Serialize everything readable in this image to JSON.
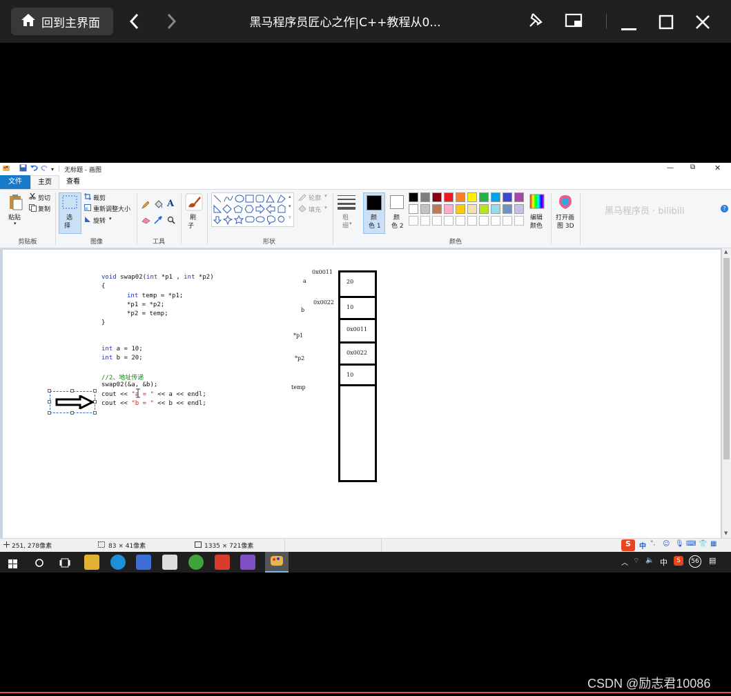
{
  "player": {
    "home_label": "回到主界面",
    "title": "黑马程序员匠心之作|C++教程从0..."
  },
  "paint": {
    "quick_access": {
      "title": "无标题 - 画图"
    },
    "tabs": [
      {
        "label": "文件"
      },
      {
        "label": "主页"
      },
      {
        "label": "查看"
      }
    ],
    "watermark": "黑马程序员 · bilibili",
    "ribbon": {
      "clipboard": {
        "paste": "粘贴",
        "cut": "剪切",
        "copy": "复制",
        "label": "剪贴板"
      },
      "image": {
        "select": "选",
        "select2": "择",
        "crop": "裁剪",
        "resize": "重新调整大小",
        "rotate": "旋转",
        "label": "图像"
      },
      "tools": {
        "label": "工具"
      },
      "brush": {
        "label1": "刷",
        "label2": "子"
      },
      "shapes": {
        "outline": "轮廓",
        "fill": "填充",
        "label": "形状"
      },
      "size": {
        "label1": "粗",
        "label2": "细"
      },
      "color1": {
        "label1": "颜",
        "label2": "色 1"
      },
      "color2": {
        "label1": "颜",
        "label2": "色 2"
      },
      "edit_colors": {
        "label1": "编辑",
        "label2": "颜色"
      },
      "paint3d": {
        "label1": "打开画",
        "label2": "图 3D"
      },
      "colors_label": "颜色"
    },
    "palette_row1": [
      "#000000",
      "#7f7f7f",
      "#880015",
      "#ed1c24",
      "#ff7f27",
      "#fff200",
      "#22b14c",
      "#00a2e8",
      "#3f48cc",
      "#a349a4"
    ],
    "palette_row2": [
      "#ffffff",
      "#c3c3c3",
      "#b97a57",
      "#ffaec9",
      "#ffc90e",
      "#efe4b0",
      "#b5e61d",
      "#99d9ea",
      "#7092be",
      "#c8bfe7"
    ],
    "code": {
      "l1_void": "void",
      "l1_sig": " swap02(",
      "l1_int1": "int",
      "l1_p1": " *p1 , ",
      "l1_int2": "int",
      "l1_p2": " *p2)",
      "l2": "{",
      "l3_int": "int",
      "l3_rest": " temp = *p1;",
      "l4": "*p1 = *p2;",
      "l5": "*p2 = temp;",
      "l6": "}",
      "l7_int": "int",
      "l7_rest": " a = 10;",
      "l8_int": "int",
      "l8_rest": " b = 20;",
      "l9": "//2、地址传递",
      "l10": "swap02(&a, &b);",
      "l11_a": "cout << ",
      "l11_s": "\"a = \"",
      "l11_b": " << a << endl;",
      "l12_a": "cout << ",
      "l12_s": "\"b = \"",
      "l12_b": " << b << endl;"
    },
    "memory": {
      "addr1": "0x0011",
      "addr2": "0x0022",
      "label_a": "a",
      "label_b": "b",
      "label_p1": "*p1",
      "label_p2": "*p2",
      "label_temp": "temp",
      "cells": [
        "20",
        "10",
        "0x0011",
        "0x0022",
        "10",
        ""
      ]
    },
    "status": {
      "cursor": "251, 278像素",
      "selection": "83 × 41像素",
      "canvas_size": "1335 × 721像素"
    }
  },
  "taskbar": {
    "ime": "中",
    "clock": "56"
  },
  "footer": {
    "csdn": "CSDN @励志君10086"
  }
}
